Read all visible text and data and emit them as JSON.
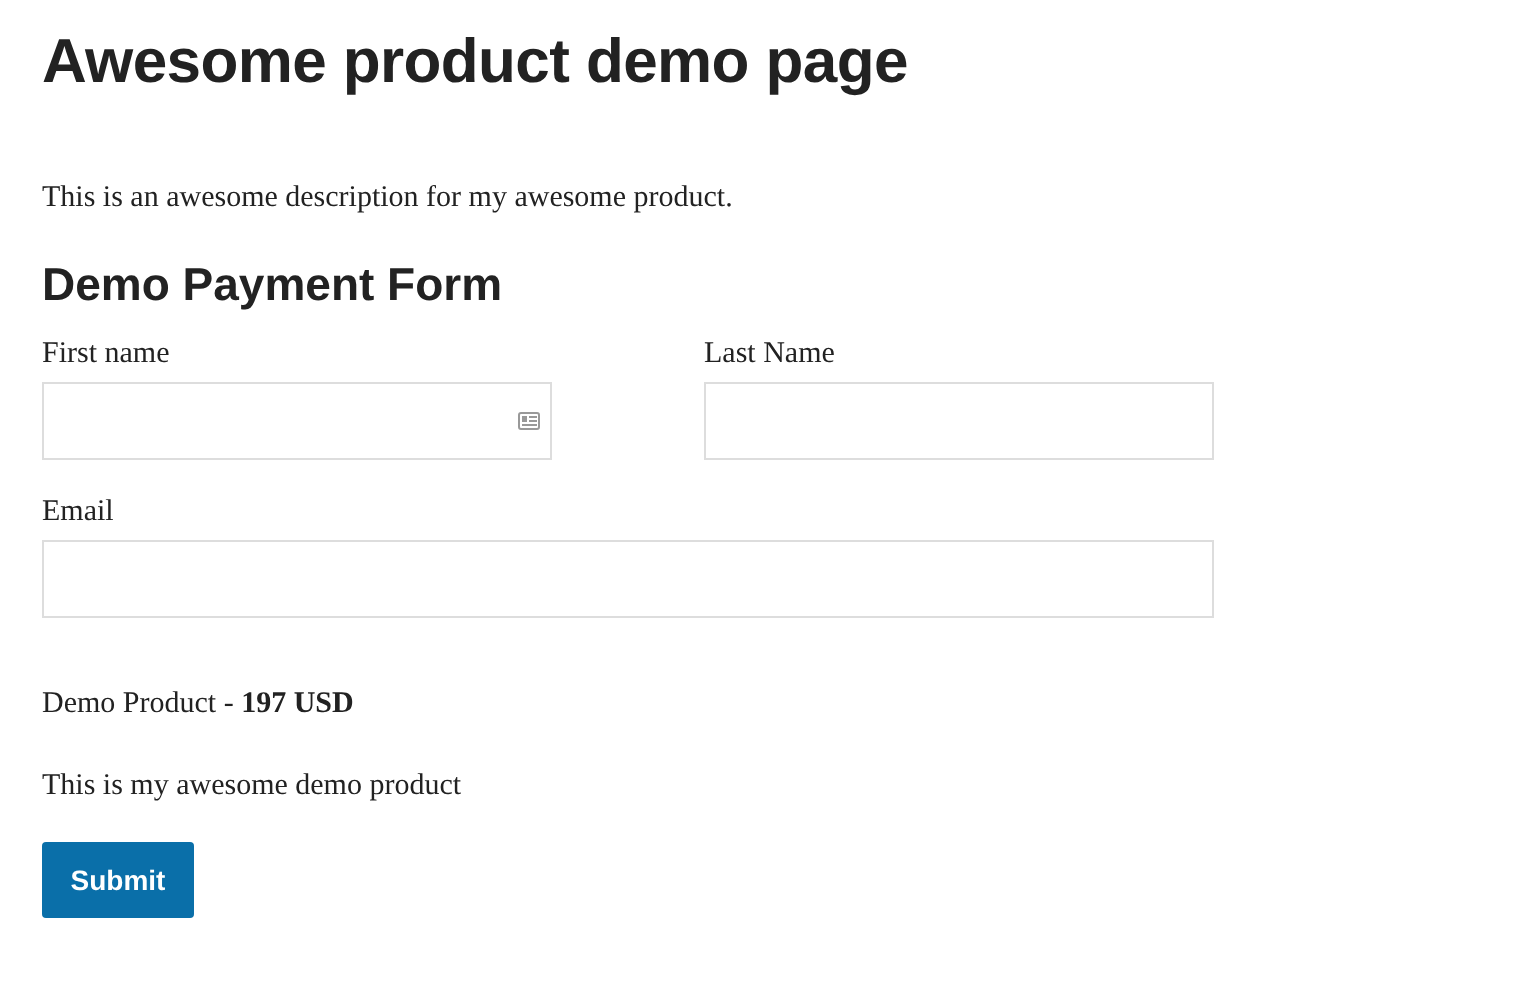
{
  "page": {
    "title": "Awesome product demo page",
    "description": "This is an awesome description for my awesome product."
  },
  "form": {
    "title": "Demo Payment Form",
    "fields": [
      {
        "label": "First name",
        "autofill_icon": true
      },
      {
        "label": "Last Name",
        "autofill_icon": false
      },
      {
        "label": "Email",
        "autofill_icon": false
      }
    ],
    "product": "Demo Product - **197 USD**",
    "product_description": "This is my awesome demo product",
    "submit": "Submit"
  }
}
